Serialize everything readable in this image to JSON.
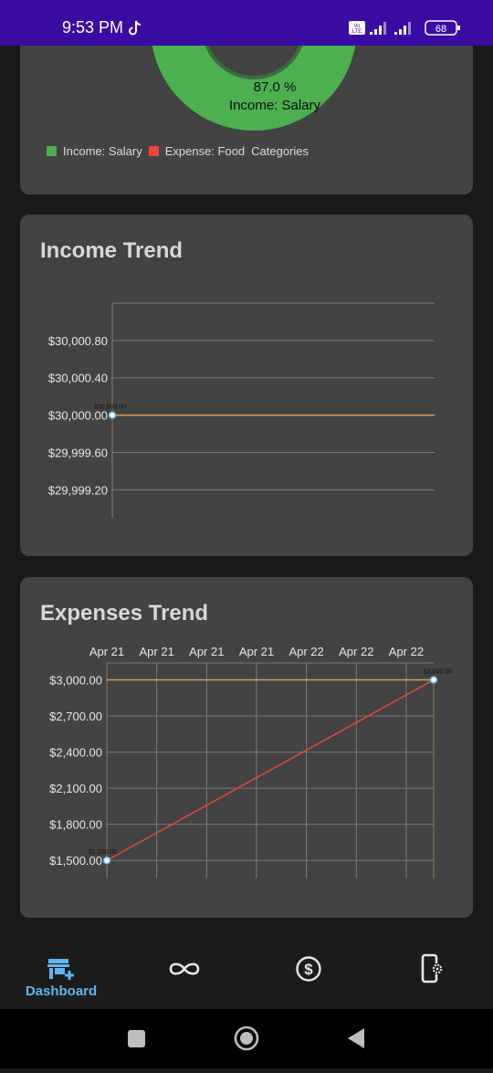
{
  "status_bar": {
    "time": "9:53 PM",
    "battery": "68",
    "lte_badge": "Vo LTE"
  },
  "category_card": {
    "donut_percent_label": "87.0 %",
    "donut_category_label": "Income: Salary",
    "legend": [
      {
        "label": "Income: Salary",
        "color": "#4caf50"
      },
      {
        "label": "Expense: Food",
        "color": "#f44336"
      }
    ],
    "legend_title": "Categories"
  },
  "income_card": {
    "title": "Income Trend"
  },
  "expenses_card": {
    "title": "Expenses Trend"
  },
  "chart_data": [
    {
      "type": "line",
      "title": "Income Trend",
      "y_tick_labels": [
        "$30,000.80",
        "$30,000.40",
        "$30,000.00",
        "$29,999.60",
        "$29,999.20"
      ],
      "y_ticks": [
        30000.8,
        30000.4,
        30000.0,
        29999.6,
        29999.2
      ],
      "ylim": [
        29998.9,
        30001.2
      ],
      "x": [
        0
      ],
      "xlim": [
        0,
        1
      ],
      "series": [
        {
          "values": [
            30000.0
          ],
          "point_labels": [
            "$30,000.00"
          ],
          "color": "#e0a050"
        }
      ],
      "grid": true
    },
    {
      "type": "line",
      "title": "Expenses Trend",
      "x_tick_labels": [
        "Apr 21",
        "Apr 21",
        "Apr 21",
        "Apr 21",
        "Apr 22",
        "Apr 22",
        "Apr 22"
      ],
      "y_tick_labels": [
        "$3,000.00",
        "$2,700.00",
        "$2,400.00",
        "$2,100.00",
        "$1,800.00",
        "$1,500.00"
      ],
      "y_ticks": [
        3000,
        2700,
        2400,
        2100,
        1800,
        1500
      ],
      "ylim": [
        1350,
        3140
      ],
      "x": [
        0,
        6.55
      ],
      "xlim": [
        0,
        6.55
      ],
      "series": [
        {
          "values": [
            1500,
            3000
          ],
          "point_labels": [
            "$1,500.00",
            "$3,000.00"
          ],
          "color": "#e04a3c"
        }
      ],
      "limit_line": 3000,
      "grid": true
    }
  ],
  "bottom_nav": {
    "items": [
      {
        "label": "Dashboard",
        "icon": "store-add-icon",
        "active": true
      },
      {
        "label": "",
        "icon": "infinity-icon",
        "active": false
      },
      {
        "label": "",
        "icon": "dollar-circle-icon",
        "active": false
      },
      {
        "label": "",
        "icon": "phone-settings-icon",
        "active": false
      }
    ]
  },
  "colors": {
    "accent": "#5fb6f0",
    "status_bar": "#3a0ca3",
    "card": "#434343",
    "income_green": "#4caf50",
    "expense_red": "#f44336"
  }
}
